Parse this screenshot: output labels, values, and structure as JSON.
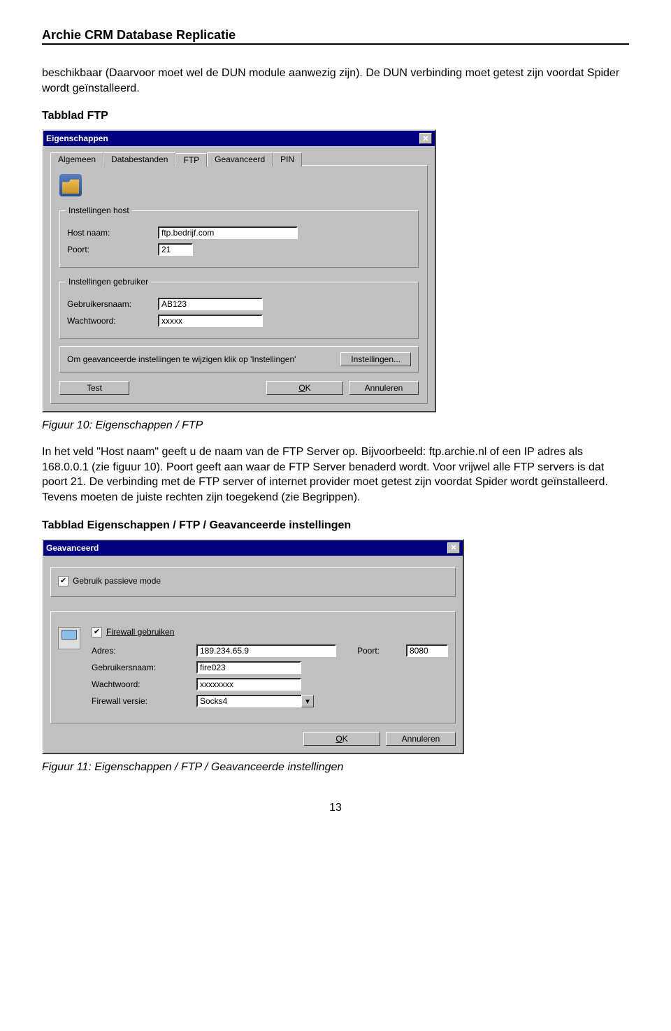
{
  "doc_title": "Archie CRM Database Replicatie",
  "p_intro": "beschikbaar (Daarvoor moet wel de DUN module aanwezig zijn). De DUN verbinding moet getest zijn voordat Spider wordt geïnstalleerd.",
  "h_ftp": "Tabblad FTP",
  "caption_fig10": "Figuur 10: Eigenschappen / FTP",
  "p_ftp": "In het veld \"Host naam\" geeft u de naam van de FTP Server op. Bijvoorbeeld: ftp.archie.nl of een IP adres als 168.0.0.1 (zie figuur 10). Poort geeft aan waar de FTP Server benaderd wordt. Voor vrijwel alle FTP servers is dat poort 21. De verbinding met de FTP server of internet provider moet getest zijn voordat Spider wordt geïnstalleerd. Tevens moeten de juiste rechten zijn toegekend (zie Begrippen).",
  "h_adv": "Tabblad Eigenschappen / FTP / Geavanceerde instellingen",
  "caption_fig11": "Figuur 11: Eigenschappen / FTP / Geavanceerde instellingen",
  "page_num": "13",
  "dlg1": {
    "title": "Eigenschappen",
    "tabs": [
      "Algemeen",
      "Databestanden",
      "FTP",
      "Geavanceerd",
      "PIN"
    ],
    "active_tab_index": 2,
    "group_host": {
      "legend": "Instellingen host",
      "host_label": "Host naam:",
      "host_value": "ftp.bedrijf.com",
      "port_label": "Poort:",
      "port_value": "21"
    },
    "group_user": {
      "legend": "Instellingen gebruiker",
      "user_label": "Gebruikersnaam:",
      "user_value": "AB123",
      "pass_label": "Wachtwoord:",
      "pass_value": "xxxxx"
    },
    "adv_text": "Om geavanceerde instellingen te wijzigen klik op 'Instellingen'",
    "adv_button": "Instellingen...",
    "btn_test": "Test",
    "btn_ok": "OK",
    "btn_cancel": "Annuleren"
  },
  "dlg2": {
    "title": "Geavanceerd",
    "chk_passive": "Gebruik passieve mode",
    "chk_firewall": "Firewall gebruiken",
    "addr_label": "Adres:",
    "addr_value": "189.234.65.9",
    "port_label": "Poort:",
    "port_value": "8080",
    "user_label": "Gebruikersnaam:",
    "user_value": "fire023",
    "pass_label": "Wachtwoord:",
    "pass_value": "xxxxxxxx",
    "ver_label": "Firewall versie:",
    "ver_value": "Socks4",
    "btn_ok": "OK",
    "btn_cancel": "Annuleren"
  }
}
